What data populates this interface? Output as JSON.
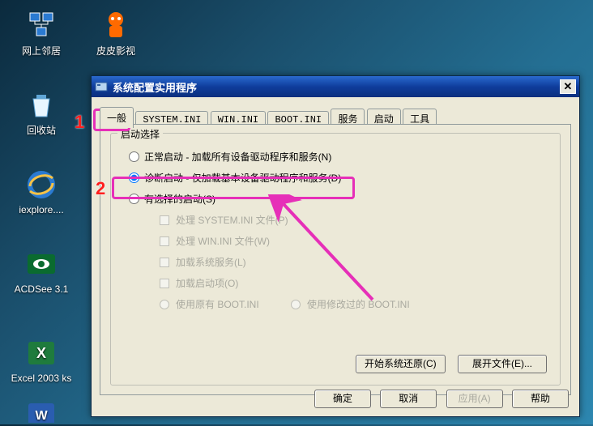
{
  "desktop": {
    "icons": [
      {
        "label": "网上邻居"
      },
      {
        "label": "皮皮影视"
      },
      {
        "label": "回收站"
      },
      {
        "label": "iexplore...."
      },
      {
        "label": "ACDSee 3.1"
      },
      {
        "label": "Excel 2003 ks"
      }
    ]
  },
  "window": {
    "title": "系统配置实用程序",
    "tabs": [
      {
        "label": "一般"
      },
      {
        "label": "SYSTEM.INI"
      },
      {
        "label": "WIN.INI"
      },
      {
        "label": "BOOT.INI"
      },
      {
        "label": "服务"
      },
      {
        "label": "启动"
      },
      {
        "label": "工具"
      }
    ],
    "active_tab": 0,
    "group_title": "启动选择",
    "radios": [
      {
        "label": "正常启动 - 加载所有设备驱动程序和服务(N)",
        "checked": false
      },
      {
        "label": "诊断启动 - 仅加载基本设备驱动程序和服务(D)",
        "checked": true
      },
      {
        "label": "有选择的启动(S)",
        "checked": false
      }
    ],
    "subchecks": [
      {
        "label": "处理 SYSTEM.INI 文件(P)"
      },
      {
        "label": "处理 WIN.INI 文件(W)"
      },
      {
        "label": "加载系统服务(L)"
      },
      {
        "label": "加载启动项(O)"
      }
    ],
    "subradios": [
      {
        "label": "使用原有 BOOT.INI"
      },
      {
        "label": "使用修改过的 BOOT.INI"
      }
    ],
    "inner_buttons": [
      {
        "label": "开始系统还原(C)"
      },
      {
        "label": "展开文件(E)..."
      }
    ],
    "outer_buttons": [
      {
        "label": "确定",
        "enabled": true
      },
      {
        "label": "取消",
        "enabled": true
      },
      {
        "label": "应用(A)",
        "enabled": false
      },
      {
        "label": "帮助",
        "enabled": true
      }
    ]
  },
  "annotations": {
    "n1": "1",
    "n2": "2"
  }
}
